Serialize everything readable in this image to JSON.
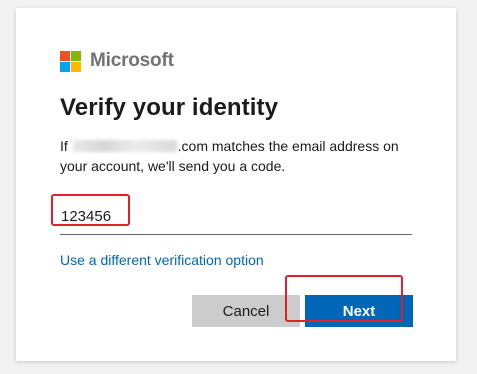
{
  "brand": {
    "name": "Microsoft",
    "logo_colors": [
      "#f25022",
      "#7fba00",
      "#00a4ef",
      "#ffb900"
    ]
  },
  "title": "Verify your identity",
  "description": {
    "prefix": "If ",
    "suffix": ".com matches the email address on your account, we'll send you a code."
  },
  "code_input": {
    "value": "123456"
  },
  "alt_option_link": "Use a different verification option",
  "buttons": {
    "cancel": "Cancel",
    "next": "Next"
  },
  "colors": {
    "accent": "#0067b8",
    "highlight": "#e0202a"
  }
}
